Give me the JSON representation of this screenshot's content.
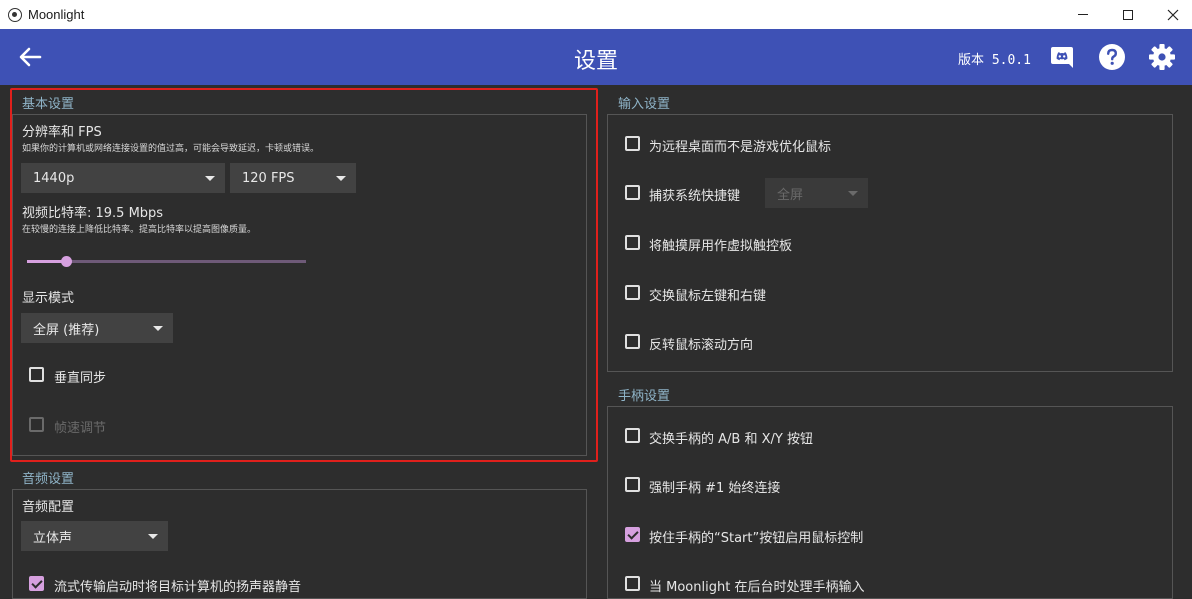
{
  "window": {
    "title": "Moonlight"
  },
  "header": {
    "title": "设置",
    "version": "版本 5.0.1"
  },
  "basic": {
    "section_title": "基本设置",
    "resolution_label": "分辨率和 FPS",
    "resolution_hint": "如果你的计算机或网络连接设置的值过高，可能会导致延迟，卡顿或错误。",
    "resolution_value": "1440p",
    "fps_value": "120 FPS",
    "bitrate_label": "视频比特率: 19.5 Mbps",
    "bitrate_hint": "在较慢的连接上降低比特率。提高比特率以提高图像质量。",
    "bitrate_slider_fraction": 0.14,
    "display_mode_label": "显示模式",
    "display_mode_value": "全屏 (推荐)",
    "vsync_label": "垂直同步",
    "vsync_checked": false,
    "frame_pacing_label": "帧速调节",
    "frame_pacing_enabled": false
  },
  "audio": {
    "section_title": "音频设置",
    "config_label": "音频配置",
    "config_value": "立体声",
    "mute_host_label": "流式传输启动时将目标计算机的扬声器静音",
    "mute_host_checked": true
  },
  "input": {
    "section_title": "输入设置",
    "items": [
      {
        "label": "为远程桌面而不是游戏优化鼠标",
        "checked": false
      },
      {
        "label": "捕获系统快捷键",
        "checked": false
      },
      {
        "label": "将触摸屏用作虚拟触控板",
        "checked": false
      },
      {
        "label": "交换鼠标左键和右键",
        "checked": false
      },
      {
        "label": "反转鼠标滚动方向",
        "checked": false
      }
    ],
    "shortcut_dropdown_value": "全屏"
  },
  "gamepad": {
    "section_title": "手柄设置",
    "items": [
      {
        "label": "交换手柄的 A/B 和 X/Y 按钮",
        "checked": false
      },
      {
        "label": "强制手柄 #1 始终连接",
        "checked": false
      },
      {
        "label": "按住手柄的“Start”按钮启用鼠标控制",
        "checked": true
      },
      {
        "label": "当 Moonlight 在后台时处理手柄输入",
        "checked": false
      }
    ]
  },
  "colors": {
    "header": "#3e51b5",
    "accent": "#d6a0df",
    "background": "#2d2d2d",
    "highlight": "#e0201c"
  },
  "icons": {
    "back": "arrow-left-icon",
    "discord": "discord-icon",
    "help": "help-icon",
    "settings": "gear-icon"
  }
}
